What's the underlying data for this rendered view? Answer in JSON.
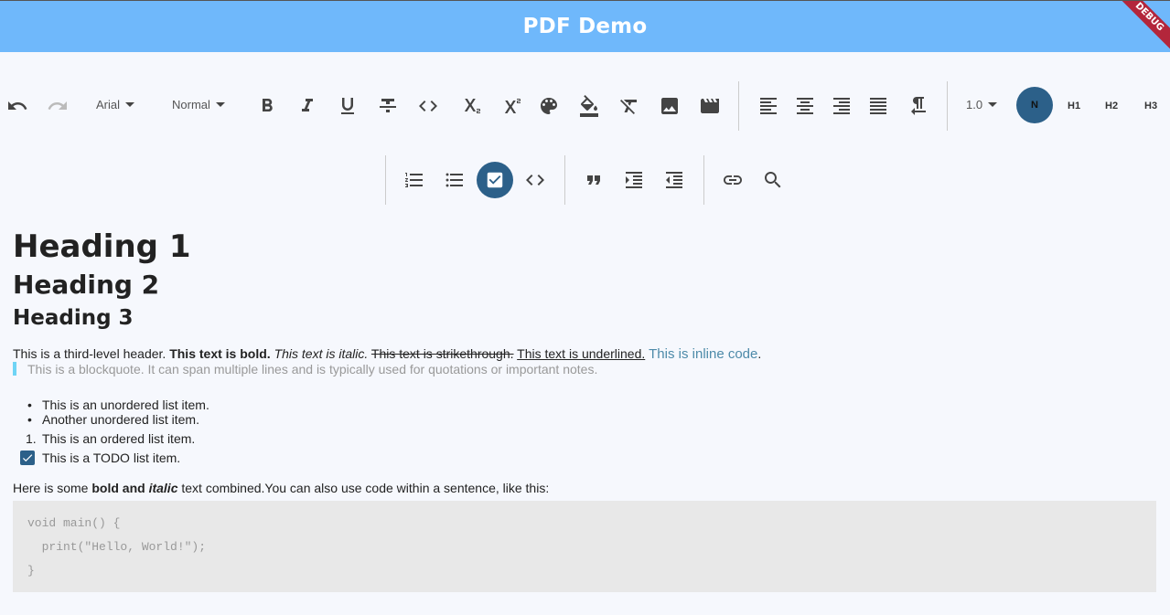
{
  "app": {
    "title": "PDF Demo",
    "debug_label": "DEBUG"
  },
  "toolbar": {
    "font_family": "Arial",
    "text_style": "Normal",
    "line_height": "1.0",
    "header_active": "N",
    "header_h1": "H1",
    "header_h2": "H2",
    "header_h3": "H3",
    "accent_color": "#2c6089"
  },
  "doc": {
    "heading1": "Heading 1",
    "heading2": "Heading 2",
    "heading3": "Heading 3",
    "line1": {
      "plain": "This is a third-level header. ",
      "bold": "This text is bold.",
      "italic": "This text is italic.",
      "strike": "This text is strikethrough.",
      "underline": "This text is underlined.",
      "code": "This is inline code",
      "period": "."
    },
    "blockquote": "This is a blockquote. It can span multiple lines and is typically used for quotations or important notes.",
    "bullet_symbol": "•",
    "unordered": [
      "This is an unordered list item.",
      "Another unordered list item."
    ],
    "ordered_number": "1.",
    "ordered": "This is an ordered list item.",
    "todo": "This is a TODO list item.",
    "combined": {
      "pre": "Here is some ",
      "bold": "bold and ",
      "bolditalic": "italic",
      "post": " text combined.You can also use code within a sentence, like this:"
    },
    "code_lines": [
      "void main() {",
      "  print(\"Hello, World!\");",
      "}"
    ]
  }
}
